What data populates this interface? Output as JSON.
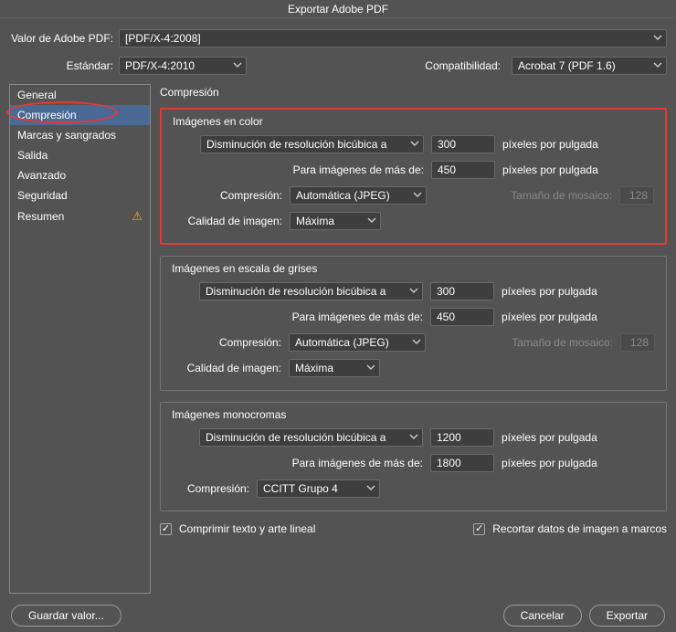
{
  "title": "Exportar Adobe PDF",
  "top": {
    "preset_label": "Valor de Adobe PDF:",
    "preset_value": "[PDF/X-4:2008]",
    "standard_label": "Estándar:",
    "standard_value": "PDF/X-4:2010",
    "compat_label": "Compatibilidad:",
    "compat_value": "Acrobat 7 (PDF 1.6)"
  },
  "sidebar": {
    "items": [
      "General",
      "Compresión",
      "Marcas y sangrados",
      "Salida",
      "Avanzado",
      "Seguridad",
      "Resumen"
    ],
    "selected": 1,
    "warning_index": 6
  },
  "content": {
    "section_title": "Compresión",
    "groups": {
      "color": {
        "title": "Imágenes en color",
        "downsample_method": "Disminución de resolución bicúbica a",
        "target_ppi": "300",
        "threshold_label": "Para imágenes de más de:",
        "threshold_ppi": "450",
        "ppi_unit": "píxeles por pulgada",
        "compression_label": "Compresión:",
        "compression_value": "Automática (JPEG)",
        "tile_label": "Tamaño de mosaico:",
        "tile_value": "128",
        "quality_label": "Calidad de imagen:",
        "quality_value": "Máxima"
      },
      "gray": {
        "title": "Imágenes en escala de grises",
        "downsample_method": "Disminución de resolución bicúbica a",
        "target_ppi": "300",
        "threshold_label": "Para imágenes de más de:",
        "threshold_ppi": "450",
        "ppi_unit": "píxeles por pulgada",
        "compression_label": "Compresión:",
        "compression_value": "Automática (JPEG)",
        "tile_label": "Tamaño de mosaico:",
        "tile_value": "128",
        "quality_label": "Calidad de imagen:",
        "quality_value": "Máxima"
      },
      "mono": {
        "title": "Imágenes monocromas",
        "downsample_method": "Disminución de resolución bicúbica a",
        "target_ppi": "1200",
        "threshold_label": "Para imágenes de más de:",
        "threshold_ppi": "1800",
        "ppi_unit": "píxeles por pulgada",
        "compression_label": "Compresión:",
        "compression_value": "CCITT Grupo 4"
      }
    },
    "checks": {
      "compress_text": "Comprimir texto y arte lineal",
      "crop_data": "Recortar datos de imagen a marcos"
    }
  },
  "footer": {
    "save_preset": "Guardar valor...",
    "cancel": "Cancelar",
    "export": "Exportar"
  }
}
